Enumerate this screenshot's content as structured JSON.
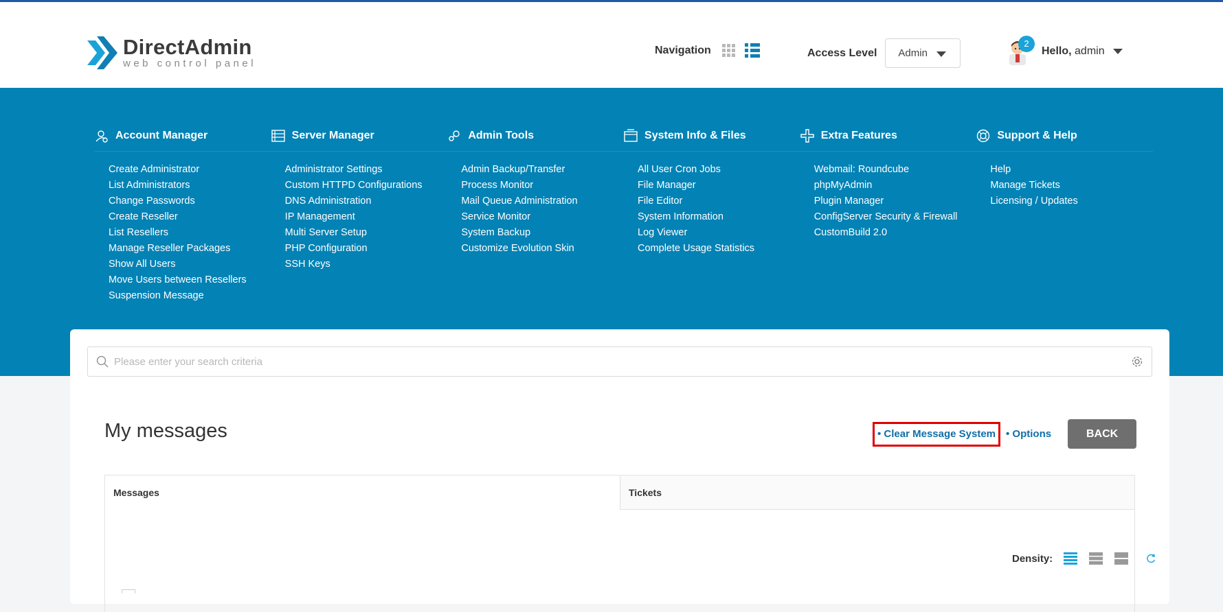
{
  "logo": {
    "title": "DirectAdmin",
    "subtitle": "web control panel"
  },
  "header": {
    "navigation_label": "Navigation",
    "access_level_label": "Access Level",
    "access_level_value": "Admin",
    "badge_count": "2",
    "hello_prefix": "Hello,",
    "username": "admin"
  },
  "menu": {
    "columns": [
      {
        "title": "Account Manager",
        "icon": "account-manager-icon",
        "items": [
          "Create Administrator",
          "List Administrators",
          "Change Passwords",
          "Create Reseller",
          "List Resellers",
          "Manage Reseller Packages",
          "Show All Users",
          "Move Users between Resellers",
          "Suspension Message"
        ]
      },
      {
        "title": "Server Manager",
        "icon": "server-manager-icon",
        "items": [
          "Administrator Settings",
          "Custom HTTPD Configurations",
          "DNS Administration",
          "IP Management",
          "Multi Server Setup",
          "PHP Configuration",
          "SSH Keys"
        ]
      },
      {
        "title": "Admin Tools",
        "icon": "admin-tools-icon",
        "items": [
          "Admin Backup/Transfer",
          "Process Monitor",
          "Mail Queue Administration",
          "Service Monitor",
          "System Backup",
          "Customize Evolution Skin"
        ]
      },
      {
        "title": "System Info & Files",
        "icon": "system-info-icon",
        "items": [
          "All User Cron Jobs",
          "File Manager",
          "File Editor",
          "System Information",
          "Log Viewer",
          "Complete Usage Statistics"
        ]
      },
      {
        "title": "Extra Features",
        "icon": "extra-features-icon",
        "items": [
          "Webmail: Roundcube",
          "phpMyAdmin",
          "Plugin Manager",
          "ConfigServer Security & Firewall",
          "CustomBuild 2.0"
        ]
      },
      {
        "title": "Support & Help",
        "icon": "support-help-icon",
        "items": [
          "Help",
          "Manage Tickets",
          "Licensing / Updates"
        ]
      }
    ]
  },
  "search": {
    "placeholder": "Please enter your search criteria"
  },
  "page": {
    "title": "My messages",
    "clear_label": "• Clear Message System",
    "options_label": "• Options",
    "back_label": "BACK"
  },
  "tabs": [
    {
      "label": "Messages"
    },
    {
      "label": "Tickets"
    }
  ],
  "density": {
    "label": "Density:"
  },
  "colors": {
    "brand_blue": "#0382b5",
    "link_blue": "#0f6fa8",
    "highlight_red": "#e00000",
    "badge": "#1aa3d9"
  }
}
